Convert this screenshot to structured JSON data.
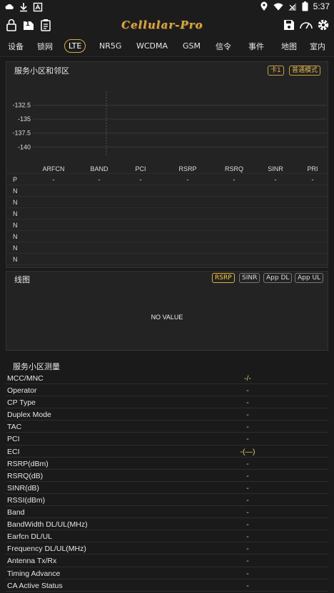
{
  "status_bar": {
    "left_icons": [
      "cloud-icon",
      "download-icon",
      "app-icon"
    ],
    "right_icons": [
      "location-icon",
      "wifi-icon",
      "no-signal-icon",
      "battery-icon"
    ],
    "battery_level": "5",
    "time": "5:37"
  },
  "toolbar": {
    "left_icons": [
      "lock-icon",
      "sim-one-icon",
      "clipboard-icon"
    ],
    "sim_label": "1",
    "logo_text": "Cellular-Pro",
    "right_icons": [
      "save-icon",
      "speedometer-icon",
      "settings-icon"
    ]
  },
  "tabs": [
    {
      "label": "设备"
    },
    {
      "label": "锁网"
    },
    {
      "label": "LTE"
    },
    {
      "label": "NR5G"
    },
    {
      "label": "WCDMA"
    },
    {
      "label": "GSM"
    },
    {
      "label": "信令"
    },
    {
      "label": "事件"
    },
    {
      "label": "地图"
    },
    {
      "label": "室内"
    }
  ],
  "active_tab": "LTE",
  "serving_panel": {
    "title": "服务小区和邻区",
    "card_chip": "卡1",
    "mode_chip": "普通模式"
  },
  "chart_data": {
    "type": "scatter",
    "title": "",
    "xlabel": "",
    "ylabel": "",
    "y_ticks": [
      "-132.5",
      "-135",
      "-137.5",
      "-140"
    ],
    "ylim": [
      -141.5,
      -130
    ],
    "grid": true,
    "series": []
  },
  "neighbor_table": {
    "columns": [
      "ARFCN",
      "BAND",
      "PCI",
      "RSRP",
      "RSRQ",
      "SINR",
      "PRI"
    ],
    "rows": [
      {
        "label": "P",
        "values": [
          "-",
          "-",
          "-",
          "-",
          "-",
          "-",
          "-"
        ]
      },
      {
        "label": "N",
        "values": [
          "",
          "",
          "",
          "",
          "",
          "",
          ""
        ]
      },
      {
        "label": "N",
        "values": [
          "",
          "",
          "",
          "",
          "",
          "",
          ""
        ]
      },
      {
        "label": "N",
        "values": [
          "",
          "",
          "",
          "",
          "",
          "",
          ""
        ]
      },
      {
        "label": "N",
        "values": [
          "",
          "",
          "",
          "",
          "",
          "",
          ""
        ]
      },
      {
        "label": "N",
        "values": [
          "",
          "",
          "",
          "",
          "",
          "",
          ""
        ]
      },
      {
        "label": "N",
        "values": [
          "",
          "",
          "",
          "",
          "",
          "",
          ""
        ]
      },
      {
        "label": "N",
        "values": [
          "",
          "",
          "",
          "",
          "",
          "",
          ""
        ]
      }
    ]
  },
  "line_chart_panel": {
    "title": "线图",
    "buttons": [
      "RSRP",
      "SINR",
      "App DL",
      "App UL"
    ],
    "selected": "RSRP",
    "empty_text": "NO VALUE"
  },
  "measurement": {
    "title": "服务小区测量",
    "rows": [
      {
        "key": "MCC/MNC",
        "value": "-/-"
      },
      {
        "key": "Operator",
        "value": "-"
      },
      {
        "key": "CP Type",
        "value": "-"
      },
      {
        "key": "Duplex Mode",
        "value": "-"
      },
      {
        "key": "TAC",
        "value": "-"
      },
      {
        "key": "PCI",
        "value": "-"
      },
      {
        "key": "ECI",
        "value": "-(—)"
      },
      {
        "key": "RSRP(dBm)",
        "value": "-"
      },
      {
        "key": "RSRQ(dB)",
        "value": "-"
      },
      {
        "key": "SINR(dB)",
        "value": "-"
      },
      {
        "key": "RSSI(dBm)",
        "value": "-"
      },
      {
        "key": "Band",
        "value": "-"
      },
      {
        "key": "BandWidth DL/UL(MHz)",
        "value": "-"
      },
      {
        "key": "Earfcn DL/UL",
        "value": "-"
      },
      {
        "key": "Frequency DL/UL(MHz)",
        "value": "-"
      },
      {
        "key": "Antenna Tx/Rx",
        "value": "-"
      },
      {
        "key": "Timing Advance",
        "value": "-"
      },
      {
        "key": "CA Active Status",
        "value": "-"
      }
    ]
  },
  "colors": {
    "accent": "#d8b040",
    "value_yellow": "#e8d070",
    "background": "#1a1a1a",
    "panel": "#232323"
  }
}
